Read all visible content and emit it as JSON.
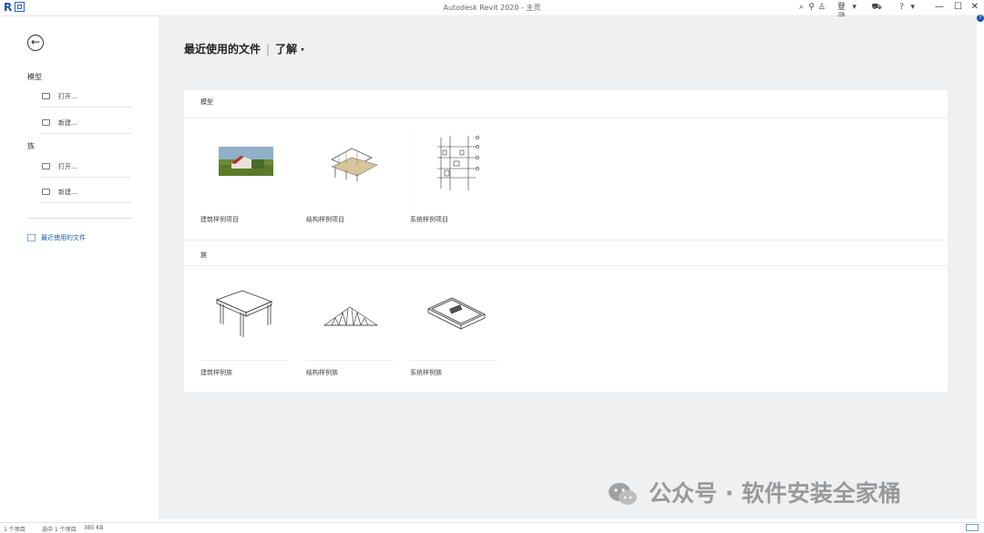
{
  "titlebar": {
    "title": "Autodesk Revit 2020 - 主页",
    "login": "登录",
    "minimize": "—",
    "maximize": "☐",
    "close": "✕"
  },
  "sidebar": {
    "model_section": "模型",
    "model_items": [
      {
        "label": "打开...",
        "icon": "open-folder-icon"
      },
      {
        "label": "新建...",
        "icon": "new-folder-icon"
      }
    ],
    "family_section": "族",
    "family_items": [
      {
        "label": "打开...",
        "icon": "open-folder-icon"
      },
      {
        "label": "新建...",
        "icon": "new-folder-icon"
      }
    ],
    "recent_files": "最近使用的文件"
  },
  "main": {
    "title": "最近使用的文件",
    "learn": "了解"
  },
  "panel": {
    "models_section": "模型",
    "models": [
      {
        "label": "建筑样例项目"
      },
      {
        "label": "结构样例项目"
      },
      {
        "label": "系统样例项目"
      }
    ],
    "families_section": "族",
    "families": [
      {
        "label": "建筑样例族"
      },
      {
        "label": "结构样例族"
      },
      {
        "label": "系统样例族"
      }
    ]
  },
  "statusbar": {
    "count": "1 个项目",
    "selected": "选中 1 个项目",
    "size": "385 KB"
  },
  "watermark": {
    "text": "公众号 · 软件安装全家桶"
  },
  "colors": {
    "accent": "#1c58a8",
    "main_bg": "#eef0f2",
    "panel_bg": "#ffffff"
  }
}
